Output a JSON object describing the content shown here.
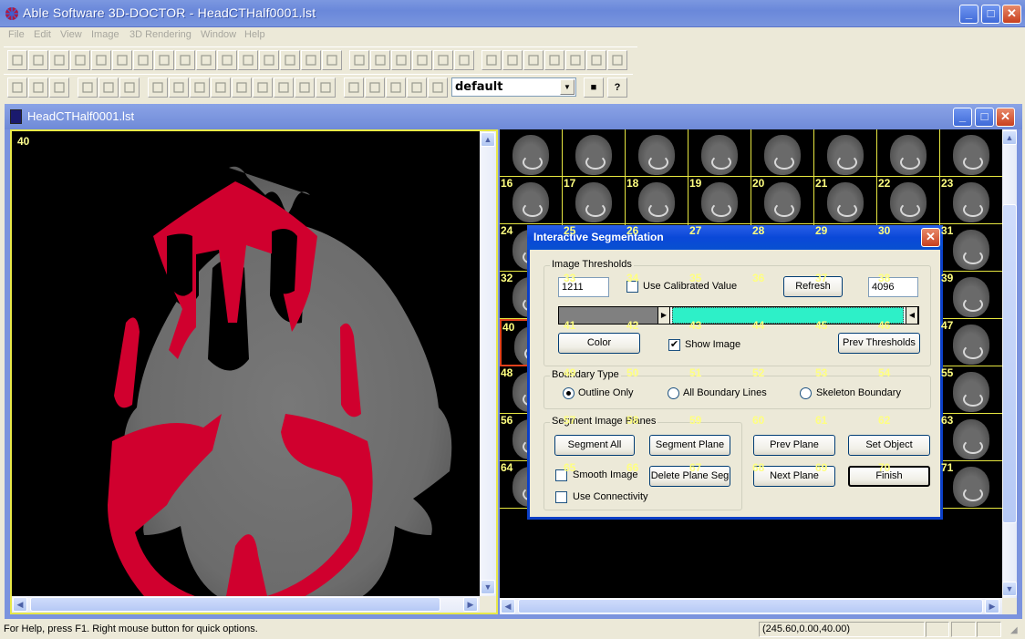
{
  "app": {
    "title": "Able Software 3D-DOCTOR - HeadCTHalf0001.lst",
    "window_buttons": {
      "minimize": "_",
      "maximize": "□",
      "close": "✕"
    }
  },
  "menu": [
    "File",
    "Edit",
    "View",
    "Image",
    "3D Rendering",
    "Window",
    "Help"
  ],
  "toolbar1": {
    "icons": [
      "select-region-icon",
      "freehand-draw-icon",
      "rectangle-icon",
      "ellipse-icon",
      "add-point-icon",
      "remove-point-icon",
      "connect-icon",
      "scatter-icon",
      "box-edit-icon",
      "line-icon",
      "crop-icon",
      "resize-icon",
      "grid-icon",
      "object-label-icon",
      "region-fill-icon",
      "histogram-icon",
      "ruler-icon",
      "measure-icon",
      "angle-icon",
      "profile-icon",
      "fill-icon",
      "chart-icon",
      "boundary-select-icon",
      "polygon-icon",
      "square-icon",
      "circle-icon",
      "edit-boundary-icon",
      "move-boundary-icon",
      "delete-boundary-icon"
    ]
  },
  "toolbar2": {
    "icons": [
      "new-file-icon",
      "open-folder-icon",
      "save-icon",
      "undo-icon",
      "pointer-icon",
      "contrast-icon",
      "zoom-in-icon",
      "zoom-out-icon",
      "camera-icon",
      "arrow-left-icon",
      "arrow-right-icon",
      "arrow-up-icon",
      "arrow-down-icon",
      "rotate-left-icon",
      "rotate-right-icon",
      "surface-render-icon",
      "green-sphere-icon",
      "connector-icon",
      "volume-render-icon",
      "axis-icon"
    ],
    "combo_value": "default",
    "after_combo_icons": [
      "object-color-icon",
      "context-help-icon"
    ]
  },
  "child_window": {
    "title": "HeadCTHalf0001.lst",
    "current_slice": "40",
    "thumbnails": {
      "rows": [
        [
          "",
          "",
          "",
          "",
          "",
          "",
          "",
          ""
        ],
        [
          "16",
          "17",
          "18",
          "19",
          "20",
          "21",
          "22",
          "23"
        ],
        [
          "24",
          "25",
          "26",
          "27",
          "28",
          "29",
          "30",
          "31"
        ],
        [
          "32",
          "33",
          "34",
          "35",
          "36",
          "37",
          "38",
          "39"
        ],
        [
          "40",
          "41",
          "42",
          "43",
          "44",
          "45",
          "46",
          "47"
        ],
        [
          "48",
          "49",
          "50",
          "51",
          "52",
          "53",
          "54",
          "55"
        ],
        [
          "56",
          "57",
          "58",
          "59",
          "60",
          "61",
          "62",
          "63"
        ],
        [
          "64",
          "65",
          "66",
          "67",
          "68",
          "69",
          "70",
          "71"
        ]
      ],
      "selected": "40"
    },
    "accent_highlight": "#e0401c",
    "segmentation_color": "#d0002e"
  },
  "dialog": {
    "title": "Interactive Segmentation",
    "thresholds": {
      "legend": "Image Thresholds",
      "low_value": "1211",
      "high_value": "4096",
      "use_calibrated_label": "Use Calibrated Value",
      "use_calibrated_checked": false,
      "refresh_label": "Refresh",
      "range_low_fraction": 0.296,
      "range_high_fraction": 1.0,
      "range_color": "#2df0c8",
      "color_label": "Color",
      "show_image_label": "Show Image",
      "show_image_checked": true,
      "prev_thresholds_label": "Prev Thresholds"
    },
    "boundary": {
      "legend": "Boundary Type",
      "options": [
        "Outline Only",
        "All Boundary Lines",
        "Skeleton Boundary"
      ],
      "selected": "Outline Only"
    },
    "segment": {
      "legend": "Segment Image Planes",
      "segment_all": "Segment All",
      "segment_plane": "Segment Plane",
      "smooth_image": "Smooth Image",
      "delete_plane_seg": "Delete Plane Seg",
      "use_connectivity": "Use Connectivity",
      "prev_plane": "Prev Plane",
      "set_object": "Set Object",
      "next_plane": "Next Plane",
      "finish": "Finish"
    }
  },
  "status": {
    "message": "For Help, press F1. Right mouse button for quick options.",
    "coords": "(245.60,0.00,40.00)"
  }
}
